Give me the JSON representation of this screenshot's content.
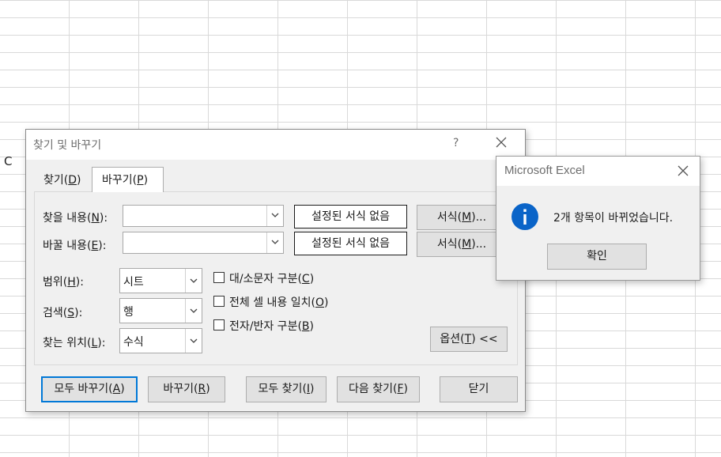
{
  "sheet": {
    "cell_text": "C"
  },
  "dialog": {
    "title": "찾기 및 바꾸기",
    "help": "?",
    "tabs": [
      {
        "label": "찾기(",
        "key": "D",
        "tail": ")"
      },
      {
        "label": "바꾸기(",
        "key": "P",
        "tail": ")"
      }
    ],
    "find_label": {
      "pre": "찾을 내용(",
      "key": "N",
      "post": "):"
    },
    "replace_label": {
      "pre": "바꿀 내용(",
      "key": "E",
      "post": "):"
    },
    "find_value": "",
    "replace_value": "",
    "format_preview": "설정된 서식 없음",
    "format_button": {
      "pre": "서식(",
      "key": "M",
      "post": ")..."
    },
    "within": {
      "pre": "범위(",
      "key": "H",
      "post": "):",
      "value": "시트"
    },
    "search": {
      "pre": "검색(",
      "key": "S",
      "post": "):",
      "value": "행"
    },
    "look_in": {
      "pre": "찾는 위치(",
      "key": "L",
      "post": "):",
      "value": "수식"
    },
    "match_case": {
      "pre": "대/소문자 구분(",
      "key": "C",
      "post": ")",
      "checked": false
    },
    "match_entire": {
      "pre": "전체 셀 내용 일치(",
      "key": "O",
      "post": ")",
      "checked": false
    },
    "match_byte": {
      "pre": "전자/반자 구분(",
      "key": "B",
      "post": ")",
      "checked": false
    },
    "options_button": {
      "pre": "옵션(",
      "key": "T",
      "post": ") <<"
    },
    "replace_all": {
      "pre": "모두 바꾸기(",
      "key": "A",
      "post": ")"
    },
    "replace": {
      "pre": "바꾸기(",
      "key": "R",
      "post": ")"
    },
    "find_all": {
      "pre": "모두 찾기(",
      "key": "I",
      "post": ")"
    },
    "find_next": {
      "pre": "다음 찾기(",
      "key": "F",
      "post": ")"
    },
    "close": "닫기"
  },
  "msgbox": {
    "title": "Microsoft Excel",
    "message": "2개 항목이 바뀌었습니다.",
    "ok": "확인",
    "accent": "#0a64c8"
  }
}
